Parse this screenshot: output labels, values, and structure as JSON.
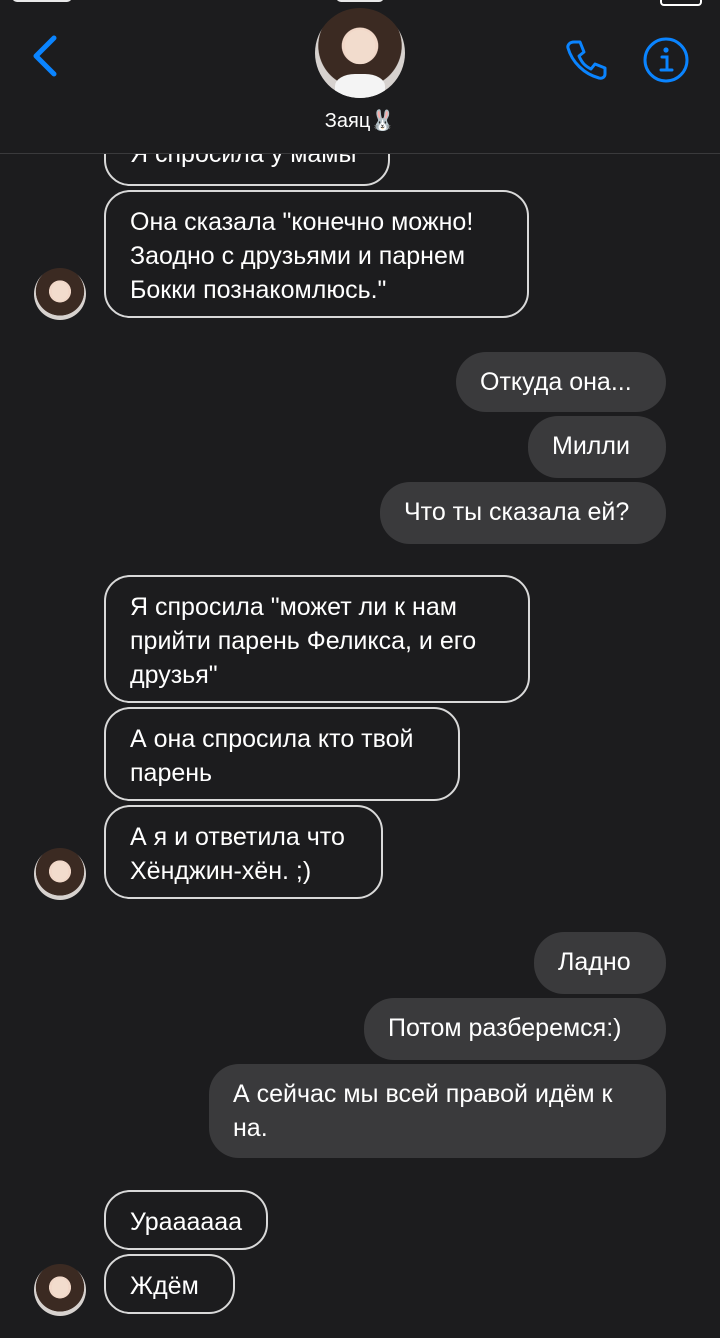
{
  "contact": {
    "name": "Заяц🐰"
  },
  "colors": {
    "accent": "#0a84ff",
    "background": "#1c1c1e",
    "outgoing_bubble": "#3a3a3c",
    "incoming_border": "#d9d9d9"
  },
  "icons": {
    "back": "chevron-left-icon",
    "call": "phone-icon",
    "info": "info-icon"
  },
  "messages": [
    {
      "side": "in",
      "text": "Я спросила у мамы"
    },
    {
      "side": "in",
      "text": "Она сказала \"конечно можно! Заодно с друзьями и парнем Бокки познакомлюсь.\""
    },
    {
      "side": "out",
      "text": "Откуда она..."
    },
    {
      "side": "out",
      "text": "Милли"
    },
    {
      "side": "out",
      "text": "Что ты сказала ей?"
    },
    {
      "side": "in",
      "text": "Я спросила \"может ли к нам прийти парень Феликса, и его друзья\""
    },
    {
      "side": "in",
      "text": "А она спросила кто твой парень"
    },
    {
      "side": "in",
      "text": "А я и ответила что Хёнджин-хён. ;)"
    },
    {
      "side": "out",
      "text": "Ладно"
    },
    {
      "side": "out",
      "text": "Потом разберемся:)"
    },
    {
      "side": "out",
      "text": "А сейчас мы всей правой идём к на."
    },
    {
      "side": "in",
      "text": "Ураааааа"
    },
    {
      "side": "in",
      "text": "Ждём"
    }
  ]
}
